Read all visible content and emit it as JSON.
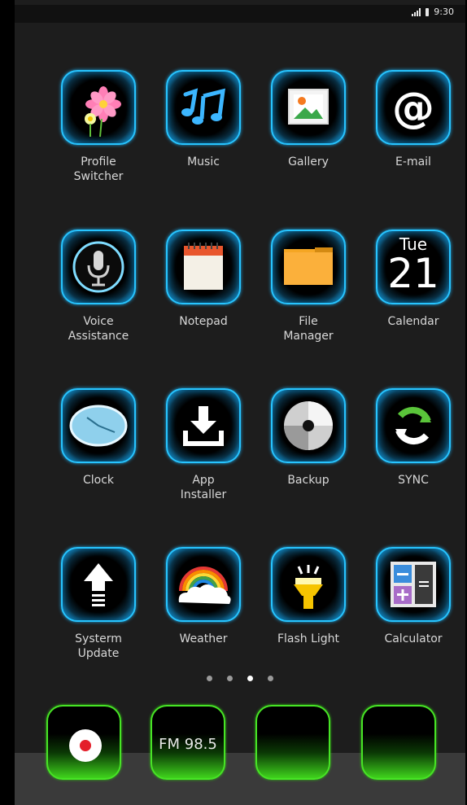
{
  "status_bar": {
    "time": "9:30"
  },
  "apps": [
    {
      "label": "Profile\nSwitcher",
      "icon": "flower-icon"
    },
    {
      "label": "Music",
      "icon": "music-notes-icon"
    },
    {
      "label": "Gallery",
      "icon": "picture-icon"
    },
    {
      "label": "E-mail",
      "icon": "at-sign-icon"
    },
    {
      "label": "Voice\nAssistance",
      "icon": "microphone-icon"
    },
    {
      "label": "Notepad",
      "icon": "notepad-icon"
    },
    {
      "label": "File\nManager",
      "icon": "folder-icon"
    },
    {
      "label": "Calendar",
      "icon": "calendar-icon",
      "day": "Tue",
      "date": "21"
    },
    {
      "label": "Clock",
      "icon": "clock-icon"
    },
    {
      "label": "App\nInstaller",
      "icon": "download-icon"
    },
    {
      "label": "Backup",
      "icon": "disc-icon"
    },
    {
      "label": "SYNC",
      "icon": "sync-icon"
    },
    {
      "label": "Systerm\nUpdate",
      "icon": "arrow-up-icon"
    },
    {
      "label": "Weather",
      "icon": "rainbow-cloud-icon"
    },
    {
      "label": "Flash Light",
      "icon": "flashlight-icon"
    },
    {
      "label": "Calculator",
      "icon": "calculator-icon"
    }
  ],
  "page_indicator": {
    "pages": 4,
    "current": 3
  },
  "dock": [
    {
      "icon": "record-icon"
    },
    {
      "icon": "radio-icon",
      "text": "FM 98.5"
    },
    {
      "icon": "blank-tile-icon"
    },
    {
      "icon": "blank-tile-icon"
    }
  ],
  "colors": {
    "accent_blue": "#27c4ff",
    "accent_green": "#47e425",
    "background": "#1d1d1d"
  }
}
